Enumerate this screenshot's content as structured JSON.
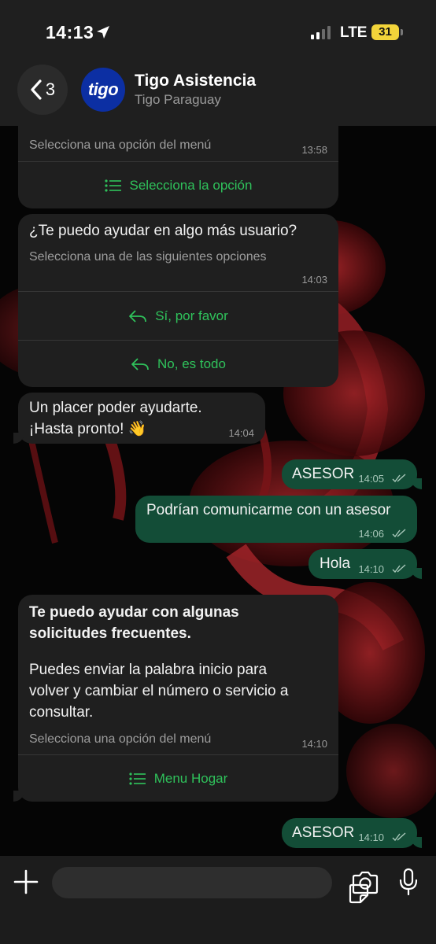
{
  "status_bar": {
    "time": "14:13",
    "network": "LTE",
    "battery": "31"
  },
  "header": {
    "back_count": "3",
    "avatar_text": "tigo",
    "name": "Tigo Asistencia",
    "subtitle": "Tigo Paraguay"
  },
  "messages": [
    {
      "sub": "Selecciona una opción del menú",
      "time": "13:58",
      "action": "Selecciona la opción"
    },
    {
      "text": "¿Te puedo ayudar en algo más usuario?",
      "sub": "Selecciona una de las siguientes opciones",
      "time": "14:03",
      "actions": [
        "Sí, por favor",
        "No, es todo"
      ]
    },
    {
      "text": "Un placer poder ayudarte.\n¡Hasta pronto! 👋",
      "time": "14:04"
    },
    {
      "text": "ASESOR",
      "time": "14:05"
    },
    {
      "text": "Podrían comunicarme con un asesor",
      "time": "14:06"
    },
    {
      "text": "Hola",
      "time": "14:10"
    },
    {
      "title": "Te puedo ayudar con algunas\nsolicitudes frecuentes.",
      "text": "Puedes enviar la palabra inicio para\nvolver y cambiar el número o servicio a\nconsultar.",
      "sub": "Selecciona una opción del menú",
      "time": "14:10",
      "action": "Menu Hogar"
    },
    {
      "text": "ASESOR",
      "time": "14:10"
    }
  ],
  "colors": {
    "accent": "#2fc25b",
    "outgoing_bubble": "#134d37",
    "incoming_bubble": "#1f1f1f",
    "brand": "#0c2fa3"
  }
}
